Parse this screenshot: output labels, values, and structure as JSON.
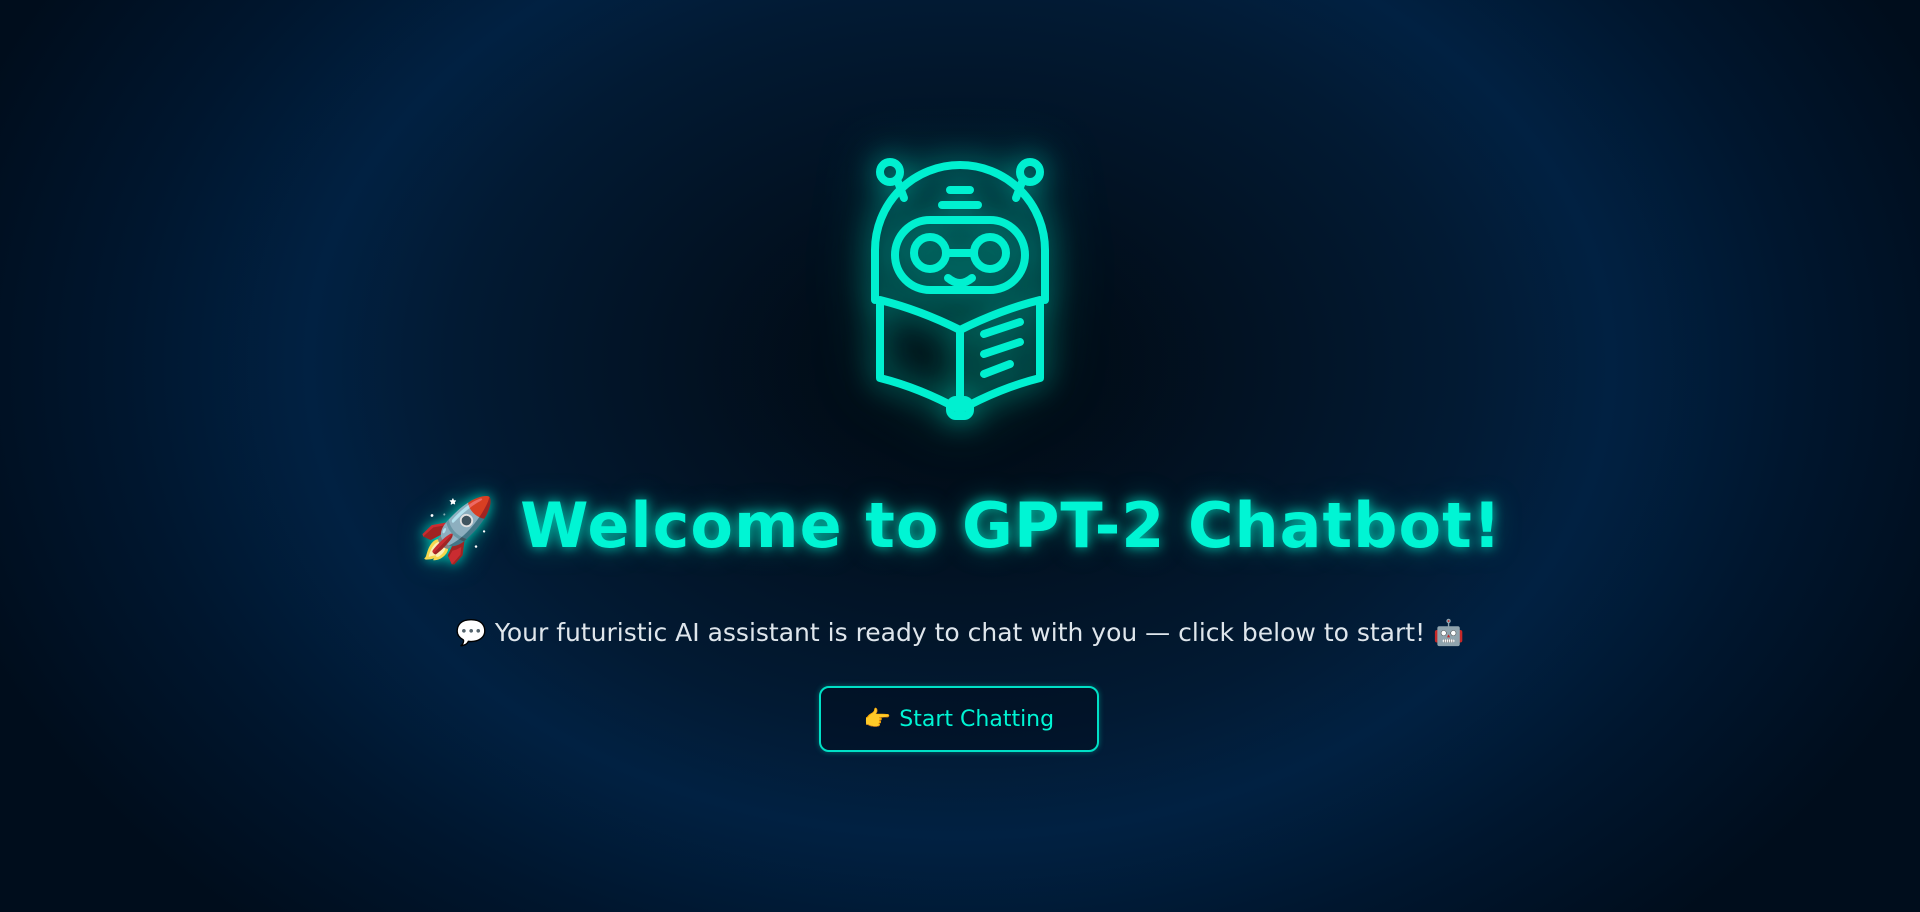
{
  "hero": {
    "icon": "robot-reading-book-icon",
    "title": {
      "emoji": "🚀",
      "text": "Welcome to GPT-2 Chatbot!"
    },
    "subtitle": "💬 Your futuristic AI assistant is ready to chat with you — click below to start! 🤖",
    "cta": {
      "emoji": "👉",
      "label": "Start Chatting"
    }
  },
  "colors": {
    "accent": "#00f5d4",
    "background": "#001a33",
    "text": "#dfe6ec"
  }
}
